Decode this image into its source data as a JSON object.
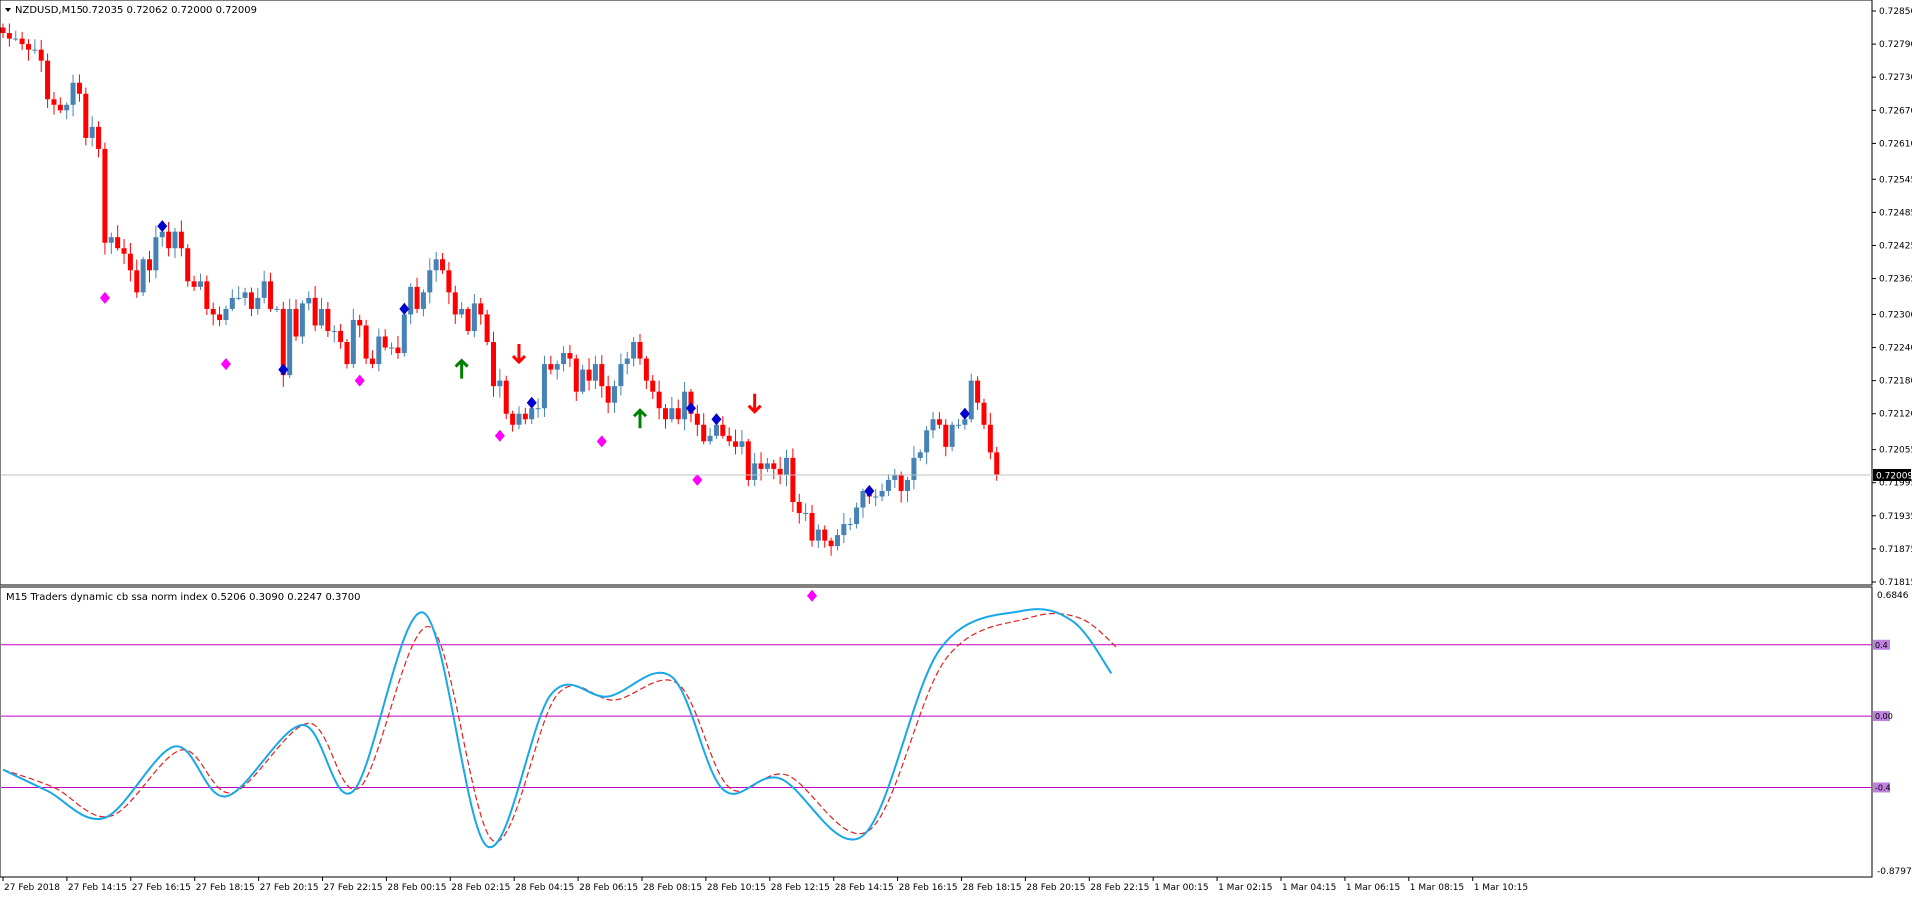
{
  "main_panel": {
    "header": {
      "symbol": "NZDUSD,M15",
      "ohlc": "0.72035 0.72062 0.72000 0.72009"
    },
    "price_labels": [
      "0.72850",
      "0.72790",
      "0.72730",
      "0.72670",
      "0.72610",
      "0.72545",
      "0.72485",
      "0.72425",
      "0.72365",
      "0.72300",
      "0.72240",
      "0.72180",
      "0.72120",
      "0.72055",
      "0.71995",
      "0.71935",
      "0.71875",
      "0.71815"
    ],
    "current_price_label": "0.72009",
    "colors": {
      "bull": "#4682b4",
      "bear": "#ff0000",
      "current_line": "#c0c0c0"
    }
  },
  "indicator_panel": {
    "header": "M15  Traders dynamic cb ssa norm index 0.5206 0.3090 0.2247 0.3700",
    "scale_top": "0.6846",
    "scale_bottom": "-0.8797",
    "level_labels": [
      "0.4",
      "0.00",
      "-0.4"
    ],
    "colors": {
      "main_line": "#1aa7e8",
      "signal_line": "#e02020",
      "level_line": "#c000c0"
    }
  },
  "time_labels": [
    "27 Feb 2018",
    "27 Feb 14:15",
    "27 Feb 16:15",
    "27 Feb 18:15",
    "27 Feb 20:15",
    "27 Feb 22:15",
    "28 Feb 00:15",
    "28 Feb 02:15",
    "28 Feb 04:15",
    "28 Feb 06:15",
    "28 Feb 08:15",
    "28 Feb 10:15",
    "28 Feb 12:15",
    "28 Feb 14:15",
    "28 Feb 16:15",
    "28 Feb 18:15",
    "28 Feb 20:15",
    "28 Feb 22:15",
    "1 Mar 00:15",
    "1 Mar 02:15",
    "1 Mar 04:15",
    "1 Mar 06:15",
    "1 Mar 08:15",
    "1 Mar 10:15"
  ],
  "chart_data": [
    {
      "type": "candlestick",
      "title": "NZDUSD,M15",
      "ylim": [
        0.71815,
        0.7285
      ],
      "close_series": [
        [
          0,
          0.7281
        ],
        [
          1,
          0.728
        ],
        [
          2,
          0.728
        ],
        [
          3,
          0.7279
        ],
        [
          4,
          0.7278
        ],
        [
          5,
          0.7278
        ],
        [
          6,
          0.7276
        ],
        [
          7,
          0.7269
        ],
        [
          8,
          0.7268
        ],
        [
          9,
          0.7267
        ],
        [
          10,
          0.7268
        ],
        [
          11,
          0.7272
        ],
        [
          12,
          0.727
        ],
        [
          13,
          0.7262
        ],
        [
          14,
          0.7264
        ],
        [
          15,
          0.726
        ],
        [
          16,
          0.7243
        ],
        [
          17,
          0.7244
        ],
        [
          18,
          0.7242
        ],
        [
          19,
          0.7241
        ],
        [
          20,
          0.7238
        ],
        [
          21,
          0.7234
        ],
        [
          22,
          0.724
        ],
        [
          23,
          0.7238
        ],
        [
          24,
          0.7244
        ],
        [
          25,
          0.7245
        ],
        [
          26,
          0.7242
        ],
        [
          27,
          0.7245
        ],
        [
          28,
          0.7242
        ],
        [
          29,
          0.7236
        ],
        [
          30,
          0.7235
        ],
        [
          31,
          0.7236
        ],
        [
          32,
          0.7231
        ],
        [
          33,
          0.723
        ],
        [
          34,
          0.7229
        ],
        [
          35,
          0.7231
        ],
        [
          36,
          0.7233
        ],
        [
          37,
          0.7233
        ],
        [
          38,
          0.7234
        ],
        [
          39,
          0.7231
        ],
        [
          40,
          0.7233
        ],
        [
          41,
          0.7236
        ],
        [
          42,
          0.7231
        ],
        [
          43,
          0.7231
        ],
        [
          44,
          0.7219
        ],
        [
          45,
          0.7231
        ],
        [
          46,
          0.7226
        ],
        [
          47,
          0.7232
        ],
        [
          48,
          0.7233
        ],
        [
          49,
          0.7228
        ],
        [
          50,
          0.7231
        ],
        [
          51,
          0.7227
        ],
        [
          52,
          0.7227
        ],
        [
          53,
          0.7225
        ],
        [
          54,
          0.7221
        ],
        [
          55,
          0.7229
        ],
        [
          56,
          0.7228
        ],
        [
          57,
          0.7222
        ],
        [
          58,
          0.7221
        ],
        [
          59,
          0.7226
        ],
        [
          60,
          0.7224
        ],
        [
          61,
          0.7224
        ],
        [
          62,
          0.7223
        ],
        [
          63,
          0.723
        ],
        [
          64,
          0.7235
        ],
        [
          65,
          0.7231
        ],
        [
          66,
          0.7234
        ],
        [
          67,
          0.7238
        ],
        [
          68,
          0.724
        ],
        [
          69,
          0.7238
        ],
        [
          70,
          0.7234
        ],
        [
          71,
          0.723
        ],
        [
          72,
          0.7231
        ],
        [
          73,
          0.7227
        ],
        [
          74,
          0.7232
        ],
        [
          75,
          0.723
        ],
        [
          76,
          0.7225
        ],
        [
          77,
          0.7217
        ],
        [
          78,
          0.7218
        ],
        [
          79,
          0.7212
        ],
        [
          80,
          0.721
        ],
        [
          81,
          0.7212
        ],
        [
          82,
          0.7211
        ],
        [
          83,
          0.7213
        ],
        [
          84,
          0.7213
        ],
        [
          85,
          0.7221
        ],
        [
          86,
          0.722
        ],
        [
          87,
          0.7221
        ],
        [
          88,
          0.7223
        ],
        [
          89,
          0.7222
        ],
        [
          90,
          0.7216
        ],
        [
          91,
          0.722
        ],
        [
          92,
          0.7218
        ],
        [
          93,
          0.7221
        ],
        [
          94,
          0.7217
        ],
        [
          95,
          0.7214
        ],
        [
          96,
          0.7217
        ],
        [
          97,
          0.7221
        ],
        [
          98,
          0.7222
        ],
        [
          99,
          0.7225
        ],
        [
          100,
          0.7222
        ],
        [
          101,
          0.7218
        ],
        [
          102,
          0.7216
        ],
        [
          103,
          0.7213
        ],
        [
          104,
          0.7211
        ],
        [
          105,
          0.7213
        ],
        [
          106,
          0.7211
        ],
        [
          107,
          0.7216
        ],
        [
          108,
          0.7212
        ],
        [
          109,
          0.721
        ],
        [
          110,
          0.7207
        ],
        [
          111,
          0.7208
        ],
        [
          112,
          0.721
        ],
        [
          113,
          0.7208
        ],
        [
          114,
          0.7207
        ],
        [
          115,
          0.7206
        ],
        [
          116,
          0.7207
        ],
        [
          117,
          0.72
        ],
        [
          118,
          0.7203
        ],
        [
          119,
          0.7202
        ],
        [
          120,
          0.7203
        ],
        [
          121,
          0.7202
        ],
        [
          122,
          0.7201
        ],
        [
          123,
          0.7204
        ],
        [
          124,
          0.7196
        ],
        [
          125,
          0.7194
        ],
        [
          126,
          0.7194
        ],
        [
          127,
          0.7189
        ],
        [
          128,
          0.7191
        ],
        [
          129,
          0.7189
        ],
        [
          130,
          0.7188
        ],
        [
          131,
          0.719
        ],
        [
          132,
          0.7192
        ],
        [
          133,
          0.7192
        ],
        [
          134,
          0.7195
        ],
        [
          135,
          0.7198
        ],
        [
          136,
          0.7197
        ],
        [
          137,
          0.7197
        ],
        [
          138,
          0.7198
        ],
        [
          139,
          0.72
        ],
        [
          140,
          0.7201
        ],
        [
          141,
          0.7198
        ],
        [
          142,
          0.72
        ],
        [
          143,
          0.7204
        ],
        [
          144,
          0.7205
        ],
        [
          145,
          0.7209
        ],
        [
          146,
          0.7211
        ],
        [
          147,
          0.721
        ],
        [
          148,
          0.7206
        ],
        [
          149,
          0.721
        ],
        [
          150,
          0.721
        ],
        [
          151,
          0.7211
        ],
        [
          152,
          0.7218
        ],
        [
          153,
          0.7214
        ],
        [
          154,
          0.721
        ],
        [
          155,
          0.7205
        ],
        [
          156,
          0.7201
        ]
      ],
      "arrows": [
        {
          "type": "buy",
          "index": 72
        },
        {
          "type": "sell",
          "index": 81
        },
        {
          "type": "buy",
          "index": 100
        },
        {
          "type": "sell",
          "index": 118
        },
        {
          "type": "buy",
          "index": 157
        }
      ],
      "diamonds": [
        {
          "color": "#0000cd",
          "index": 25
        },
        {
          "color": "#0000cd",
          "index": 44
        },
        {
          "color": "#0000cd",
          "index": 63
        },
        {
          "color": "#0000cd",
          "index": 83
        },
        {
          "color": "#0000cd",
          "index": 108
        },
        {
          "color": "#0000cd",
          "index": 112
        },
        {
          "color": "#0000cd",
          "index": 136
        },
        {
          "color": "#0000cd",
          "index": 151
        },
        {
          "color": "#ff00ff",
          "index": 16
        },
        {
          "color": "#ff00ff",
          "index": 35
        },
        {
          "color": "#ff00ff",
          "index": 56
        },
        {
          "color": "#ff00ff",
          "index": 78
        },
        {
          "color": "#ff00ff",
          "index": 94
        },
        {
          "color": "#ff00ff",
          "index": 109
        },
        {
          "color": "#ff00ff",
          "index": 127
        }
      ]
    },
    {
      "type": "line",
      "title": "Traders dynamic cb ssa norm index",
      "ylim": [
        -0.8797,
        0.6846
      ],
      "levels": [
        0.4,
        0.0,
        -0.4
      ],
      "series": [
        {
          "values": [
            [
              0,
              -0.3
            ],
            [
              7,
              -0.42
            ],
            [
              16,
              -0.57
            ],
            [
              27,
              -0.17
            ],
            [
              35,
              -0.45
            ],
            [
              47,
              -0.05
            ],
            [
              55,
              -0.42
            ],
            [
              66,
              0.58
            ],
            [
              76,
              -0.73
            ],
            [
              86,
              0.12
            ],
            [
              95,
              0.11
            ],
            [
              105,
              0.22
            ],
            [
              113,
              -0.41
            ],
            [
              122,
              -0.35
            ],
            [
              135,
              -0.67
            ],
            [
              147,
              0.37
            ],
            [
              160,
              0.59
            ],
            [
              168,
              0.53
            ],
            [
              174,
              0.24
            ]
          ]
        },
        {
          "values": [
            [
              0,
              -0.3
            ],
            [
              8,
              -0.4
            ],
            [
              17,
              -0.56
            ],
            [
              28,
              -0.19
            ],
            [
              36,
              -0.43
            ],
            [
              48,
              -0.04
            ],
            [
              56,
              -0.4
            ],
            [
              67,
              0.5
            ],
            [
              77,
              -0.7
            ],
            [
              87,
              0.12
            ],
            [
              96,
              0.09
            ],
            [
              106,
              0.18
            ],
            [
              114,
              -0.4
            ],
            [
              123,
              -0.33
            ],
            [
              136,
              -0.64
            ],
            [
              148,
              0.32
            ],
            [
              161,
              0.55
            ],
            [
              169,
              0.55
            ],
            [
              175,
              0.38
            ]
          ]
        }
      ]
    }
  ]
}
